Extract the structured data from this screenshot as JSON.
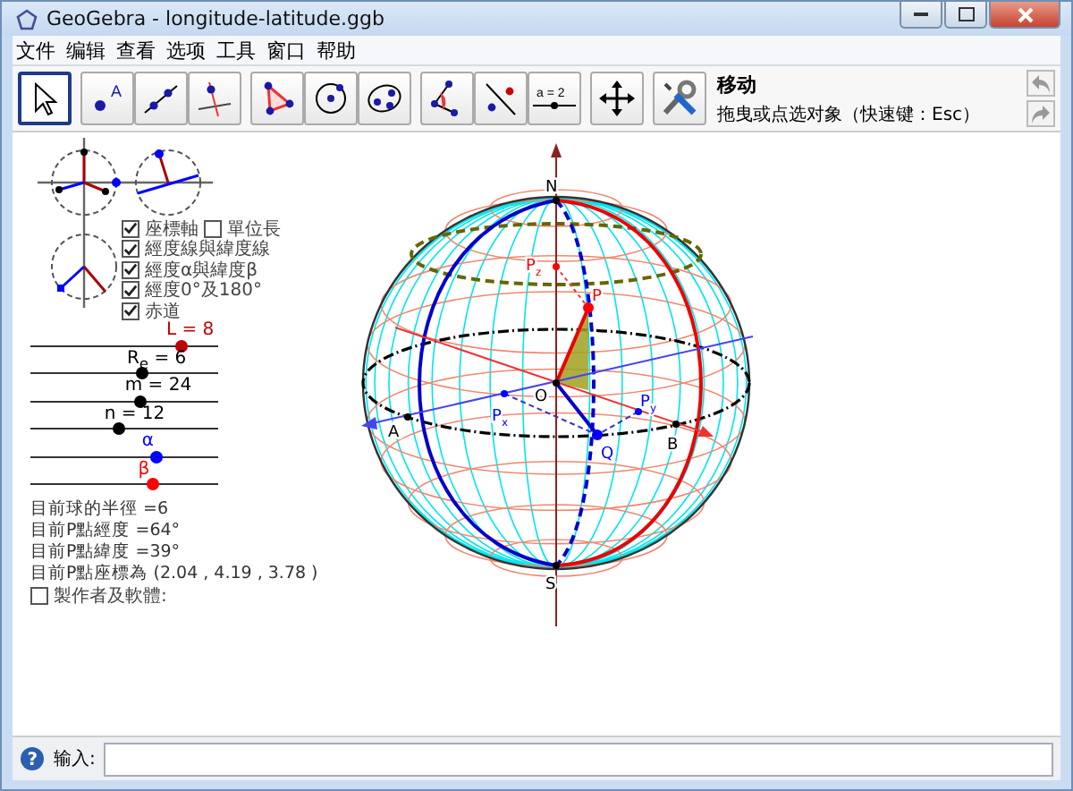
{
  "window": {
    "title": "GeoGebra - longitude-latitude.ggb"
  },
  "menu": [
    "文件",
    "编辑",
    "查看",
    "选项",
    "工具",
    "窗口",
    "帮助"
  ],
  "toolbar": {
    "tools": [
      {
        "kind": "move",
        "selected": true
      },
      {
        "kind": "point",
        "selected": false,
        "icon_text": "A"
      },
      {
        "kind": "line",
        "selected": false
      },
      {
        "kind": "perpendicular",
        "selected": false
      },
      {
        "kind": "polygon",
        "selected": false
      },
      {
        "kind": "circle",
        "selected": false
      },
      {
        "kind": "conic",
        "selected": false
      },
      {
        "kind": "angle",
        "selected": false
      },
      {
        "kind": "reflect",
        "selected": false
      },
      {
        "kind": "slider",
        "selected": false,
        "icon_text": "a = 2"
      },
      {
        "kind": "move-view",
        "selected": false
      },
      {
        "kind": "settings",
        "selected": false
      }
    ],
    "tool_name": "移动",
    "tool_help": "拖曳或点选对象（快速键：Esc）"
  },
  "panel": {
    "checkbox_rows": [
      {
        "items": [
          {
            "label": "座標軸",
            "checked": true
          },
          {
            "label": "單位長",
            "checked": false
          }
        ]
      },
      {
        "items": [
          {
            "label": "經度線與緯度線",
            "checked": true
          }
        ]
      },
      {
        "items": [
          {
            "label": "經度α與緯度β",
            "checked": true
          }
        ]
      },
      {
        "items": [
          {
            "label": "經度0°及180°",
            "checked": true
          }
        ]
      },
      {
        "items": [
          {
            "label": "赤道",
            "checked": true
          }
        ]
      }
    ],
    "sliders": [
      {
        "label": "L = 8",
        "level": 0.8,
        "color": "#c00000"
      },
      {
        "label": "R$_{e}$ = 6",
        "level": 0.59,
        "color": "#000000"
      },
      {
        "label": "m = 24",
        "level": 0.58,
        "color": "#000000"
      },
      {
        "label": "n = 12",
        "level": 0.47,
        "color": "#000000"
      },
      {
        "label": "α",
        "level": 0.67,
        "color": "#0000ff"
      },
      {
        "label": "β",
        "level": 0.65,
        "color": "#ff0000"
      }
    ],
    "info": [
      "目前球的半徑 =6",
      "目前P點經度 =64°",
      "目前P點緯度 =39°",
      "目前P點座標為 (2.04 , 4.19 , 3.78 )"
    ],
    "credits": {
      "label": "製作者及軟體:",
      "checked": false
    }
  },
  "sphere": {
    "labels": [
      {
        "text": "N",
        "color": "#000000"
      },
      {
        "text": "S",
        "color": "#000000"
      },
      {
        "text": "O",
        "color": "#000000"
      },
      {
        "text": "A",
        "color": "#000000"
      },
      {
        "text": "B",
        "color": "#000000"
      },
      {
        "text": "P",
        "color": "#ff0000"
      },
      {
        "text": "P$_{z}$",
        "color": "#ff0000"
      },
      {
        "text": "P$_{x}$",
        "color": "#0000ff"
      },
      {
        "text": "P$_{y}$",
        "color": "#0000ff"
      },
      {
        "text": "Q",
        "color": "#0000ff"
      }
    ]
  },
  "input_bar": {
    "help_icon": "?",
    "label": "输入:"
  }
}
